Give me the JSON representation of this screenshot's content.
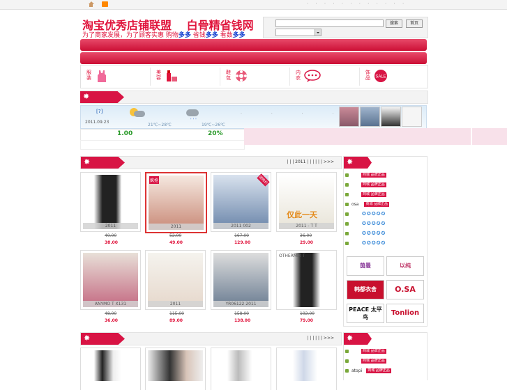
{
  "topbar": {
    "dots": "· · · · · · · · · · · ·"
  },
  "header": {
    "logo_title": "淘宝优秀店铺联盟",
    "logo_title2": "白骨精省钱网",
    "slogan_prefix": "为了商家发展，为了顾客实惠  购物",
    "slogan_b1": "多多",
    "slogan_mid1": "  省钱",
    "slogan_b2": "多多",
    "slogan_mid2": "  看数",
    "slogan_b3": "多多",
    "search_button": "搜索",
    "home_button": "首页"
  },
  "categories": [
    {
      "label": "服装",
      "icon": "tank-top-icon"
    },
    {
      "label": "美容",
      "icon": "cosmetics-icon"
    },
    {
      "label": "鞋包",
      "icon": "shoe-icon"
    },
    {
      "label": "内衣",
      "icon": "speech-bubble-icon"
    },
    {
      "label": "饰品",
      "icon": "sale-tag-icon"
    }
  ],
  "notice": {
    "badge": "✸"
  },
  "weather": {
    "city": "[?]",
    "date": "2011.09.23",
    "day1_temp": "21℃~28℃",
    "day2_temp": "19℃~26℃",
    "extra": ". . . ."
  },
  "rates": {
    "rate1": "1.00",
    "rate2": "20%"
  },
  "section1": {
    "badge": "✸",
    "nav": "|   |   | 2011  |   |   |   |   |   | >>>",
    "products": [
      {
        "caption": "2011",
        "old_price": "40.00",
        "new_price": "38.00",
        "color": "#e8e8e8"
      },
      {
        "caption": "2011",
        "old_price": "52.00",
        "new_price": "49.00",
        "color": "#ead6c8",
        "tag": "疯抢"
      },
      {
        "caption": "2011          002",
        "old_price": "167.00",
        "new_price": "129.00",
        "color": "#c9d4e3",
        "tag": "团购价"
      },
      {
        "caption": "2011  -  T  T",
        "old_price": "36.00",
        "new_price": "29.00",
        "color": "#f3eedb",
        "promo": "仅此一天"
      },
      {
        "caption": "ANYMO         T X131",
        "old_price": "48.00",
        "new_price": "36.00",
        "color": "#e0b8c2"
      },
      {
        "caption": "2011",
        "old_price": "115.00",
        "new_price": "89.00",
        "color": "#f1ede4"
      },
      {
        "caption": "YR06122  2011",
        "old_price": "158.00",
        "new_price": "138.00",
        "color": "#b7c4d2"
      },
      {
        "caption": "OTHERMIX          T",
        "old_price": "102.00",
        "new_price": "79.00",
        "color": "#efefef"
      }
    ]
  },
  "section2": {
    "badge": "✸",
    "nav": "|   |   |   |   |   | >>>"
  },
  "sidebar1": {
    "badge": "✸",
    "items": [
      {
        "text": "",
        "tag": "商城 品牌正品"
      },
      {
        "text": "",
        "tag": "商城 品牌正品"
      },
      {
        "text": "",
        "tag": "商城 品牌正品"
      },
      {
        "text": "osa",
        "tag": "商城 品牌正品"
      }
    ],
    "stars": [
      "✪✪✪✪✪",
      "✪✪✪✪✪",
      "✪✪✪✪✪",
      "✪✪✪✪✪"
    ],
    "brands": [
      "茵曼",
      "以纯",
      "韩都衣舍",
      "O.SA",
      "PEACE 太平鸟",
      "Tonlion"
    ]
  },
  "sidebar2": {
    "badge": "✸",
    "items": [
      {
        "text": "",
        "tag": "商城 品牌正品"
      },
      {
        "text": "",
        "tag": "商城 品牌正品"
      },
      {
        "text": "atopi",
        "tag": "商城 品牌正品"
      },
      {
        "text": "",
        "tag": "商城 品牌正品"
      }
    ]
  },
  "colors": {
    "accent": "#d81444",
    "blue_highlight": "#1340d0",
    "price_red": "#e0143c",
    "green": "#2a9a2a"
  }
}
